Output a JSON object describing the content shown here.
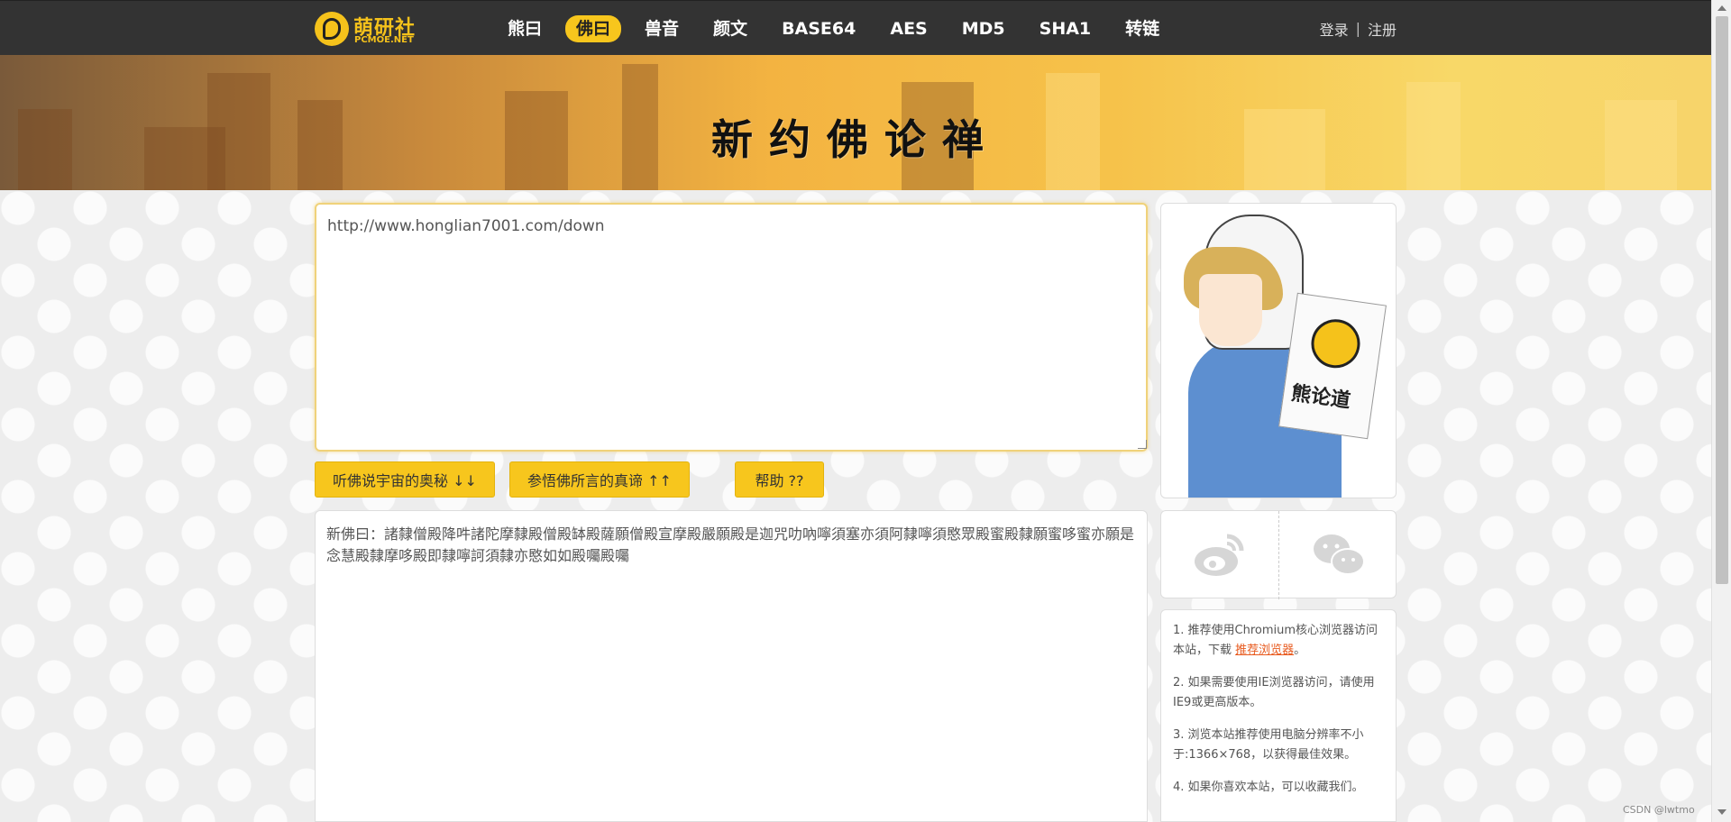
{
  "logo": {
    "title": "萌研社",
    "subtitle": "PCMOE.NET"
  },
  "nav": {
    "items": [
      {
        "label": "熊曰",
        "active": false
      },
      {
        "label": "佛曰",
        "active": true
      },
      {
        "label": "兽音",
        "active": false
      },
      {
        "label": "颜文",
        "active": false
      },
      {
        "label": "BASE64",
        "active": false
      },
      {
        "label": "AES",
        "active": false
      },
      {
        "label": "MD5",
        "active": false
      },
      {
        "label": "SHA1",
        "active": false
      },
      {
        "label": "转链",
        "active": false
      }
    ],
    "login_label": "登录",
    "separator": "|",
    "register_label": "注册"
  },
  "banner": {
    "title": "新约佛论禅"
  },
  "input": {
    "value": "http://www.honglian7001.com/down"
  },
  "buttons": {
    "encode_label": "听佛说宇宙的奥秘 ↓↓",
    "decode_label": "参悟佛所言的真谛 ↑↑",
    "help_label": "帮助 ??"
  },
  "output": {
    "value": "新佛曰：諸隸僧殿降吽諸陀摩隸殿僧殿缽殿薩願僧殿宣摩殿嚴願殿是迦咒叻吶嚀須塞亦須阿隸嚀須愍眾殿蜜殿隸願蜜哆蜜亦願是念慧殿隸摩哆殿即隸嚀訶須隸亦愍如如殿囑殿囑"
  },
  "sidebar": {
    "sign_text": "熊论道",
    "share": {
      "weibo_icon": "weibo-icon",
      "wechat_icon": "wechat-icon"
    },
    "tips": {
      "tip1_prefix": "1. 推荐使用Chromium核心浏览器访问本站，下载 ",
      "tip1_link": "推荐浏览器",
      "tip1_suffix": "。",
      "tip2": "2. 如果需要使用IE浏览器访问，请使用IE9或更高版本。",
      "tip3": "3. 浏览本站推荐使用电脑分辨率不小于:1366×768，以获得最佳效果。",
      "tip4": "4. 如果你喜欢本站，可以收藏我们。"
    }
  },
  "watermark": "CSDN @lwtmo",
  "colors": {
    "accent": "#f7c61d",
    "nav_bg": "#333333",
    "link": "#e85a1e"
  }
}
